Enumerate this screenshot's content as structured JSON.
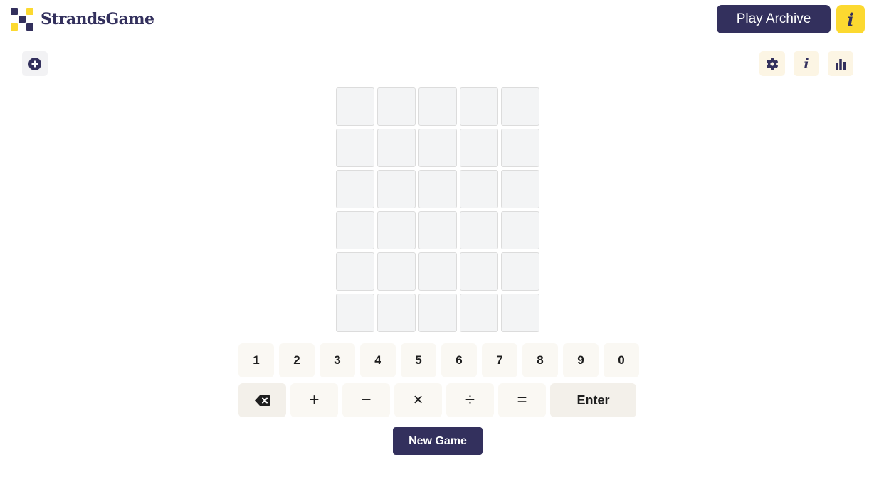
{
  "header": {
    "logo_text": "StrandsGame",
    "archive_label": "Play Archive",
    "info_label": "i"
  },
  "toolbar": {
    "add_icon": "plus-circle-icon",
    "settings_icon": "gear-icon",
    "info_label": "i",
    "stats_icon": "bar-chart-icon"
  },
  "board": {
    "rows": 6,
    "cols": 5
  },
  "keypad": {
    "digits": [
      "1",
      "2",
      "3",
      "4",
      "5",
      "6",
      "7",
      "8",
      "9",
      "0"
    ],
    "backspace_icon": "backspace-icon",
    "operators": [
      "+",
      "−",
      "×",
      "÷",
      "="
    ],
    "enter_label": "Enter"
  },
  "new_game_label": "New Game",
  "colors": {
    "brand": "#33305d",
    "accent_yellow": "#fcd930",
    "cell_bg": "#f3f4f5",
    "key_bg": "#faf8f3"
  }
}
